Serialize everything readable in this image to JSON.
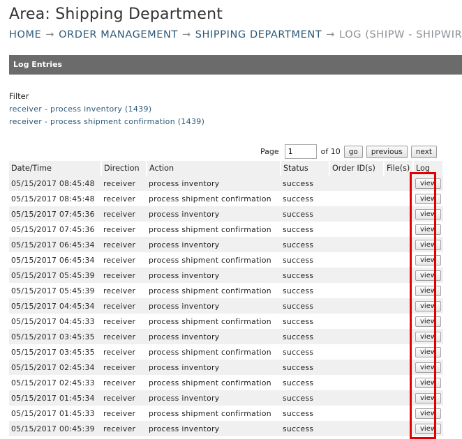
{
  "page": {
    "title": "Area: Shipping Department"
  },
  "breadcrumb": {
    "items": [
      "HOME",
      "ORDER MANAGEMENT",
      "SHIPPING DEPARTMENT"
    ],
    "current": "LOG (SHIPW - SHIPWIRE)",
    "separator": "→"
  },
  "section": {
    "title": "Log Entries"
  },
  "filter": {
    "label": "Filter",
    "links": [
      "receiver - process inventory (1439)",
      "receiver - process shipment confirmation (1439)"
    ]
  },
  "pager": {
    "label": "Page",
    "value": "1",
    "of_text": "of 10",
    "go_label": "go",
    "previous_label": "previous",
    "next_label": "next"
  },
  "table": {
    "columns": [
      "Date/Time",
      "Direction",
      "Action",
      "Status",
      "Order ID(s)",
      "File(s)",
      "Log"
    ],
    "view_label": "view",
    "rows": [
      {
        "datetime": "05/15/2017 08:45:48",
        "direction": "receiver",
        "action": "process inventory",
        "status": "success"
      },
      {
        "datetime": "05/15/2017 08:45:48",
        "direction": "receiver",
        "action": "process shipment confirmation",
        "status": "success"
      },
      {
        "datetime": "05/15/2017 07:45:36",
        "direction": "receiver",
        "action": "process inventory",
        "status": "success"
      },
      {
        "datetime": "05/15/2017 07:45:36",
        "direction": "receiver",
        "action": "process shipment confirmation",
        "status": "success"
      },
      {
        "datetime": "05/15/2017 06:45:34",
        "direction": "receiver",
        "action": "process inventory",
        "status": "success"
      },
      {
        "datetime": "05/15/2017 06:45:34",
        "direction": "receiver",
        "action": "process shipment confirmation",
        "status": "success"
      },
      {
        "datetime": "05/15/2017 05:45:39",
        "direction": "receiver",
        "action": "process inventory",
        "status": "success"
      },
      {
        "datetime": "05/15/2017 05:45:39",
        "direction": "receiver",
        "action": "process shipment confirmation",
        "status": "success"
      },
      {
        "datetime": "05/15/2017 04:45:34",
        "direction": "receiver",
        "action": "process inventory",
        "status": "success"
      },
      {
        "datetime": "05/15/2017 04:45:33",
        "direction": "receiver",
        "action": "process shipment confirmation",
        "status": "success"
      },
      {
        "datetime": "05/15/2017 03:45:35",
        "direction": "receiver",
        "action": "process inventory",
        "status": "success"
      },
      {
        "datetime": "05/15/2017 03:45:35",
        "direction": "receiver",
        "action": "process shipment confirmation",
        "status": "success"
      },
      {
        "datetime": "05/15/2017 02:45:34",
        "direction": "receiver",
        "action": "process inventory",
        "status": "success"
      },
      {
        "datetime": "05/15/2017 02:45:33",
        "direction": "receiver",
        "action": "process shipment confirmation",
        "status": "success"
      },
      {
        "datetime": "05/15/2017 01:45:34",
        "direction": "receiver",
        "action": "process inventory",
        "status": "success"
      },
      {
        "datetime": "05/15/2017 01:45:33",
        "direction": "receiver",
        "action": "process shipment confirmation",
        "status": "success"
      },
      {
        "datetime": "05/15/2017 00:45:39",
        "direction": "receiver",
        "action": "process inventory",
        "status": "success"
      }
    ]
  },
  "colors": {
    "section_bar": "#6b6b6b",
    "link": "#2b5876",
    "highlight": "#e00000",
    "row_stripe": "#f0f0f0"
  }
}
